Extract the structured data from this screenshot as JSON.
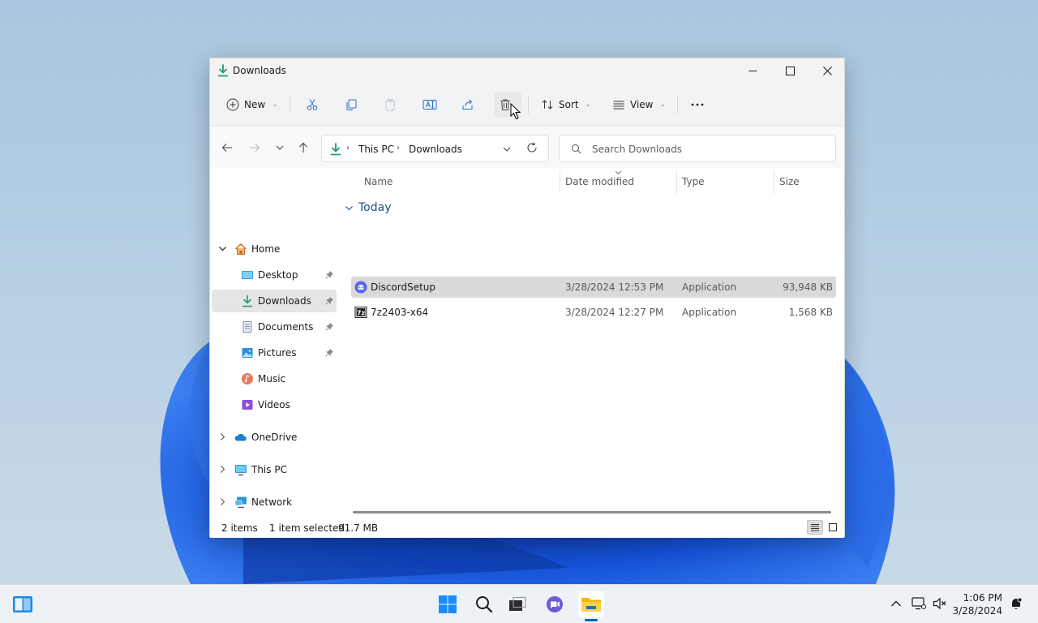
{
  "window": {
    "title": "Downloads",
    "controls": {
      "minimize": "minimize-icon",
      "maximize": "maximize-icon",
      "close": "close-icon"
    }
  },
  "commandbar": {
    "new_label": "New",
    "sort_label": "Sort",
    "view_label": "View"
  },
  "address": {
    "crumbs": [
      "This PC",
      "Downloads"
    ]
  },
  "search": {
    "placeholder": "Search Downloads"
  },
  "sidebar": {
    "items": [
      {
        "label": "Home"
      },
      {
        "label": "Desktop"
      },
      {
        "label": "Downloads"
      },
      {
        "label": "Documents"
      },
      {
        "label": "Pictures"
      },
      {
        "label": "Music"
      },
      {
        "label": "Videos"
      },
      {
        "label": "OneDrive"
      },
      {
        "label": "This PC"
      },
      {
        "label": "Network"
      }
    ]
  },
  "files": {
    "columns": [
      "Name",
      "Date modified",
      "Type",
      "Size"
    ],
    "group": "Today",
    "rows": [
      {
        "name": "DiscordSetup",
        "date": "3/28/2024 12:53 PM",
        "type": "Application",
        "size": "93,948 KB",
        "icon": "discord-icon"
      },
      {
        "name": "7z2403-x64",
        "date": "3/28/2024 12:27 PM",
        "type": "Application",
        "size": "1,568 KB",
        "icon": "7zip-icon"
      }
    ]
  },
  "status": {
    "count": "2 items",
    "selection": "1 item selected",
    "size": "91.7 MB"
  },
  "taskbar": {
    "time": "1:06 PM",
    "date": "3/28/2024"
  },
  "colors": {
    "accent": "#0067c0",
    "selected_row": "#d9d9d9",
    "group_header": "#1e4e8c"
  }
}
